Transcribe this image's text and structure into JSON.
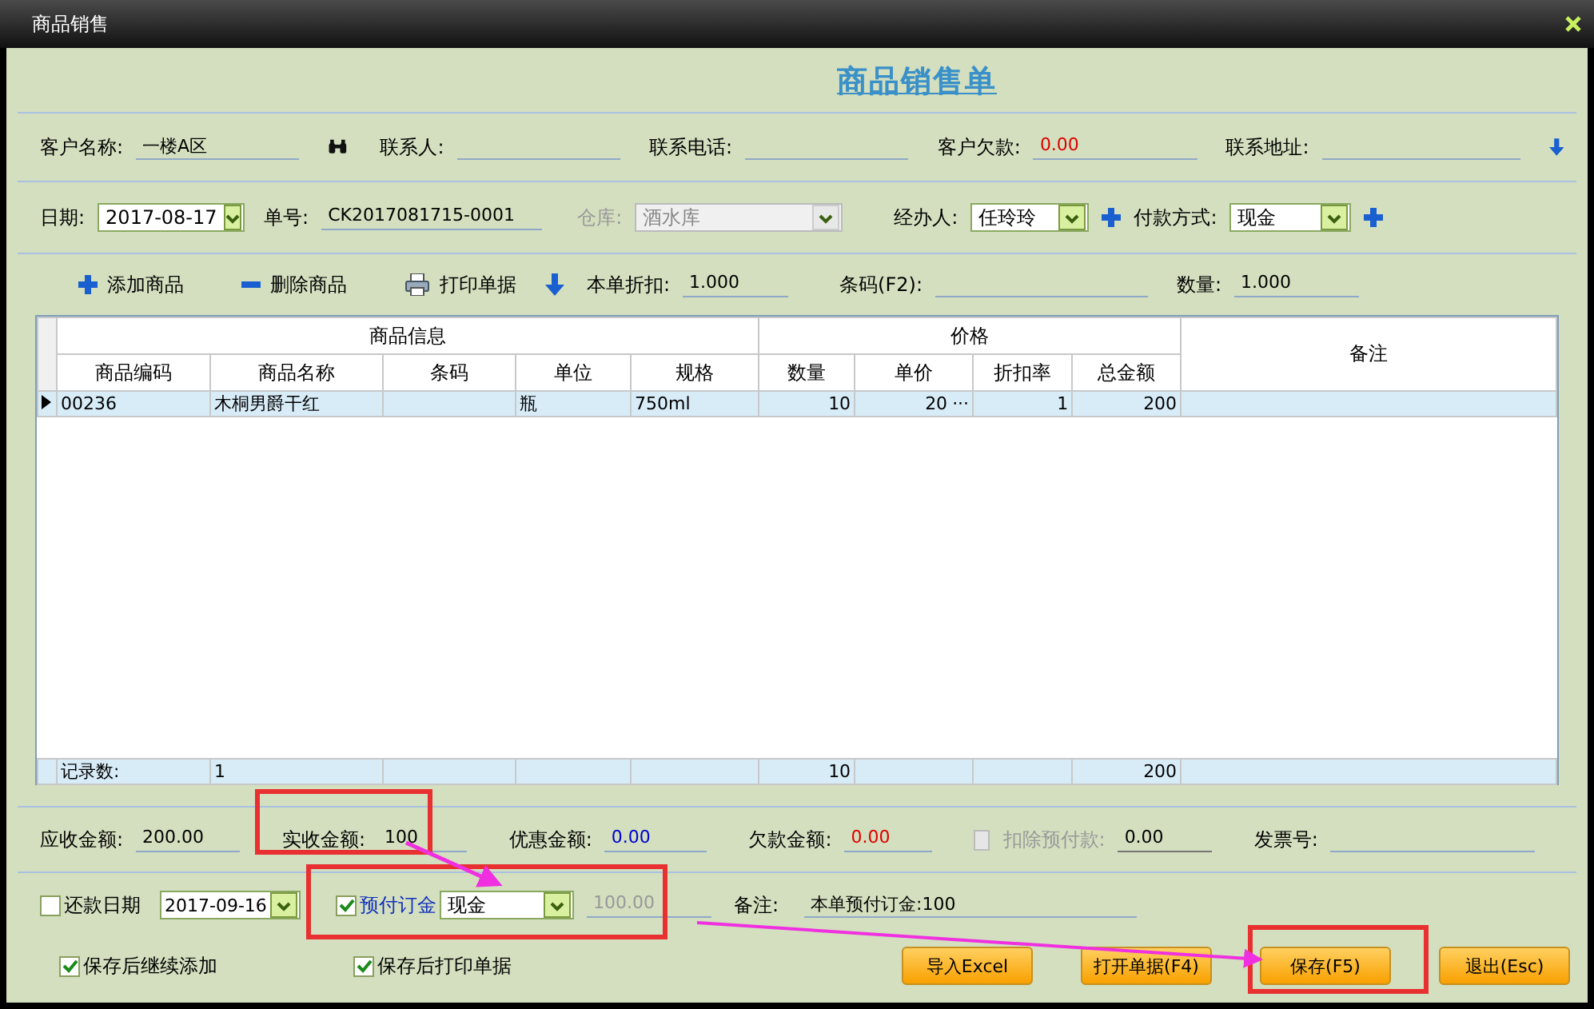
{
  "window": {
    "title": "商品销售"
  },
  "form_title": "商品销售单",
  "customer_row": [
    {
      "label": "客户名称:",
      "value": "一楼A区",
      "search": true
    },
    {
      "label": "联系人:"
    },
    {
      "label": "联系电话:"
    },
    {
      "label": "客户欠款:",
      "value": "0.00",
      "color": "#e00000"
    },
    {
      "label": "联系地址:"
    }
  ],
  "order_row": [
    {
      "label": "日期:",
      "value": "2017-08-17",
      "kind": "select",
      "disabled": false
    },
    {
      "label": "单号:",
      "value": "CK2017081715-0001",
      "kind": "text",
      "disabled": false
    },
    {
      "label": "仓库:",
      "value": "酒水库",
      "kind": "select",
      "disabled": true
    },
    {
      "label": "经办人:",
      "value": "任玲玲",
      "kind": "select",
      "disabled": false,
      "add": true
    },
    {
      "label": "付款方式:",
      "value": "现金",
      "kind": "select",
      "disabled": false,
      "add": true
    }
  ],
  "toolbar": {
    "actions": [
      {
        "label": "添加商品",
        "kind": "add"
      },
      {
        "label": "删除商品",
        "kind": "remove"
      },
      {
        "label": "打印单据",
        "kind": "print"
      }
    ],
    "fields": [
      {
        "label": "本单折扣:",
        "value": "1.000"
      },
      {
        "label": "条码(F2):"
      },
      {
        "label": "数量:",
        "value": "1.000"
      }
    ]
  },
  "table": {
    "groups": [
      "商品信息",
      "价格"
    ],
    "remark_header": "备注",
    "columns": [
      "商品编码",
      "商品名称",
      "条码",
      "单位",
      "规格",
      "数量",
      "单价",
      "折扣率",
      "总金额"
    ],
    "rows": [
      {
        "selected": true,
        "cells": [
          "00236",
          "木桐男爵干红",
          null,
          "瓶",
          "750ml",
          "10",
          "20",
          "1",
          "200"
        ],
        "price_button": "···"
      }
    ],
    "footer": {
      "label": "记录数:",
      "count": "1",
      "quantity": "10",
      "total": "200"
    }
  },
  "summary_row": [
    {
      "label": "应收金额:",
      "value": "200.00"
    },
    {
      "label": "实收金额:",
      "value": "100"
    },
    {
      "label": "优惠金额:",
      "value": "0.00",
      "color": "#0000d0"
    },
    {
      "label": "欠款金额:",
      "value": "0.00",
      "color": "#e00000"
    },
    {
      "label": "扣除预付款:",
      "value": "0.00",
      "checkbox": true,
      "checked": false,
      "disabled": true
    },
    {
      "label": "发票号:"
    }
  ],
  "repay": {
    "label": "还款日期",
    "checked": false,
    "date": "2017-09-16"
  },
  "deposit": {
    "label": "预付订金",
    "checked": true,
    "method": "现金",
    "amount": "100.00"
  },
  "note": {
    "label": "备注:",
    "value": "本单预付订金:100"
  },
  "options": [
    {
      "label": "保存后继续添加",
      "checked": true
    },
    {
      "label": "保存后打印单据",
      "checked": true
    }
  ],
  "buttons": [
    "导入Excel",
    "打开单据(F4)",
    "保存(F5)",
    "退出(Esc)"
  ]
}
